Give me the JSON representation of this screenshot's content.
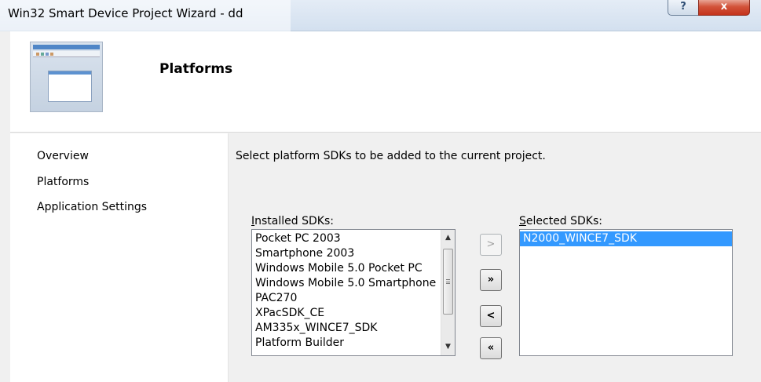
{
  "window": {
    "title": "Win32 Smart Device Project Wizard - dd",
    "help_glyph": "?",
    "close_glyph": "x"
  },
  "header": {
    "page_title": "Platforms"
  },
  "nav": {
    "items": [
      {
        "label": "Overview"
      },
      {
        "label": "Platforms"
      },
      {
        "label": "Application Settings"
      }
    ]
  },
  "content": {
    "instruction": "Select platform SDKs to be added to the current project.",
    "installed": {
      "label_prefix": "I",
      "label_rest": "nstalled SDKs:",
      "items": [
        "Pocket PC 2003",
        "Smartphone 2003",
        "Windows Mobile 5.0 Pocket PC",
        "Windows Mobile 5.0 Smartphone",
        "PAC270",
        "XPacSDK_CE",
        "AM335x_WINCE7_SDK",
        "Platform Builder"
      ]
    },
    "selected": {
      "label_prefix": "S",
      "label_rest": "elected SDKs:",
      "items": [
        "N2000_WINCE7_SDK"
      ]
    },
    "buttons": {
      "add_one": ">",
      "add_all": "»",
      "remove_one": "<",
      "remove_all": "«"
    }
  },
  "icons": {
    "wizard_image": "wizard-window-icon",
    "scroll_up": "scroll-up-icon",
    "scroll_down": "scroll-down-icon"
  }
}
